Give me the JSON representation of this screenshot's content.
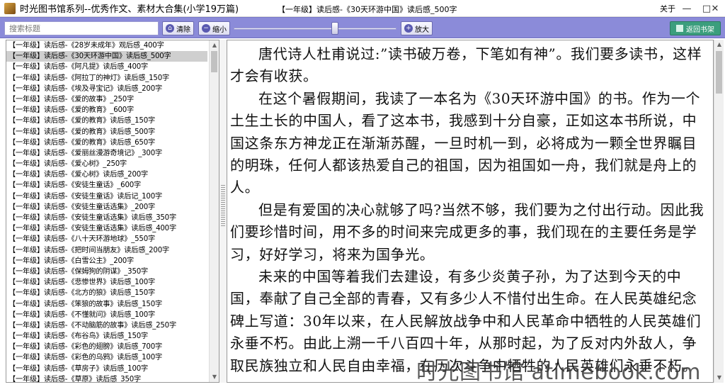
{
  "window": {
    "app_title": "时光图书馆系列--优秀作文、素材大合集(小学19万篇)",
    "doc_title": "【一年级】读后感-《30天环游中国》读后感_500字",
    "about_label": "关于",
    "minimize_glyph": "—",
    "maximize_glyph": "□",
    "close_glyph": "✕"
  },
  "toolbar": {
    "search_placeholder": "搜索标题",
    "clear_label": "清除",
    "shrink_label": "缩小",
    "enlarge_label": "放大",
    "shelf_label": "返回书架",
    "zoom_level": 0.62,
    "colors": {
      "toolbar_bg": "#8b8bd9",
      "shelf_button": "#3b9e7d"
    }
  },
  "list": {
    "selected_index": 1,
    "items": [
      "【一年级】读后感-《28岁未成年》观后感_400字",
      "【一年级】读后感-《30天环游中国》读后感_500字",
      "【一年级】读后感-《阿凡提》读后感_400字",
      "【一年级】读后感-《阿拉丁的神灯》读后感_150字",
      "【一年级】读后感-《埃及寻宝记》读后感_200字",
      "【一年级】读后感-《爱的故事》_250字",
      "【一年级】读后感-《爱的教育》_600字",
      "【一年级】读后感-《爱的教育》读后感_150字",
      "【一年级】读后感-《爱的教育》读后感_500字",
      "【一年级】读后感-《爱的教育》读后感_650字",
      "【一年级】读后感-《爱丽丝漫游奇境记》_300字",
      "【一年级】读后感-《爱心树》_250字",
      "【一年级】读后感-《爱心树》读后感_200字",
      "【一年级】读后感-《安徒生童话》_600字",
      "【一年级】读后感-《安徒生童话》读后记_100字",
      "【一年级】读后感-《安徒生童话选集》_200字",
      "【一年级】读后感-《安徒生童话选集》读后感_350字",
      "【一年级】读后感-《安徒生童话选集》读后感_400字",
      "【一年级】读后感-《八十天环游地球》_550字",
      "【一年级】读后感-《把时间当朋友》读后感_200字",
      "【一年级】读后感-《白雪公主》_200字",
      "【一年级】读后感-《保姆狗的阴谋》_350字",
      "【一年级】读后感-《悲惨世界》读后感_100字",
      "【一年级】读后感-《北方的狼》读后感_150字",
      "【一年级】读后感-《笨狼的故事》读后感_150字",
      "【一年级】读后感-《不懂就问》读后感_100字",
      "【一年级】读后感-《不动脑筋的故事》读后感_250字",
      "【一年级】读后感-《布谷鸟》读后感_150字",
      "【一年级】读后感-《彩色的翅膀》读后感_700字",
      "【一年级】读后感-《彩色的乌鸦》读后感_100字",
      "【一年级】读后感-《草房子》读后感_100字",
      "【一年级】读后感-《草原》读后感_350字"
    ]
  },
  "reader": {
    "paragraphs": [
      "唐代诗人杜甫说过:”读书破万卷，下笔如有神”。我们要多读书，这样才会有收获。",
      "在这个暑假期间，我读了一本名为《30天环游中国》的书。作为一个土生土长的中国人，看了这本书，我感到十分自豪，正如这本书所说，中国这条东方神龙正在渐渐苏醒，一旦时机一到，必将成为一颗全世界瞩目的明珠，任何人都该热爱自己的祖国，因为祖国如一舟，我们就是舟上的人。",
      "但是有爱国的决心就够了吗?当然不够，我们要为之付出行动。因此我们要珍惜时间，用不多的时间来完成更多的事，我们现在的主要任务是学习，好好学习，将来为国争光。",
      "未来的中国等着我们去建设，有多少炎黄子孙，为了达到今天的中国，奉献了自己全部的青春，又有多少人不惜付出生命。在人民英雄纪念碑上写道：30年以来，在人民解放战争中和人民革命中牺牲的人民英雄们永垂不朽。由此上溯一千八百四十年，从那时起，为了反对内外敌人，争取民族独立和人民自由幸福，在历次斗争中牺牲的人民英雄们永垂不朽。"
    ]
  },
  "watermark": "时光图书馆 atimebook.com"
}
